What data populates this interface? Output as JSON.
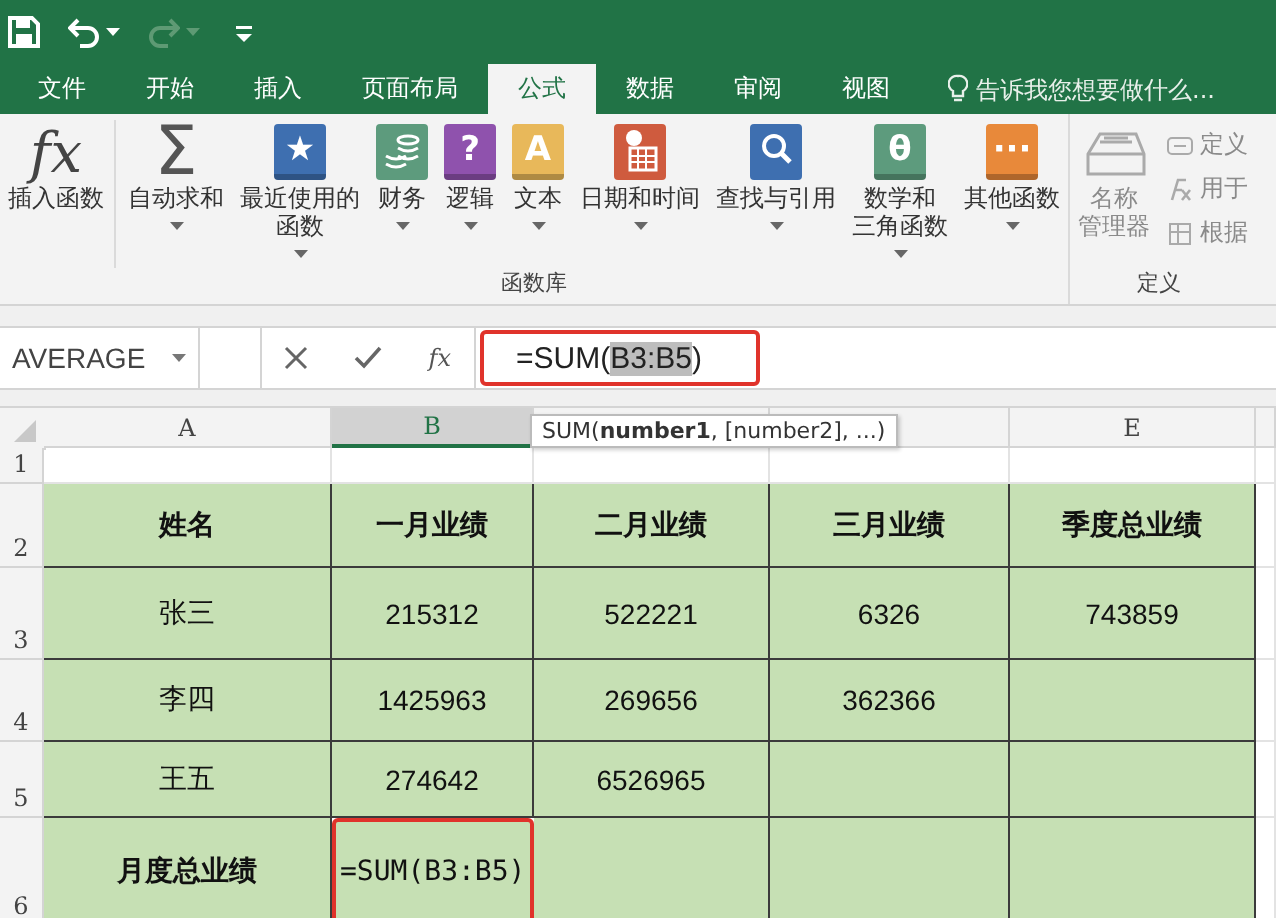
{
  "quick_access": [
    {
      "kind": "save",
      "disabled": false,
      "dropdown": false
    },
    {
      "kind": "undo",
      "disabled": false,
      "dropdown": true
    },
    {
      "kind": "redo",
      "disabled": true,
      "dropdown": true
    },
    {
      "kind": "customize",
      "disabled": false,
      "dropdown": false
    }
  ],
  "tabs": [
    {
      "label": "文件",
      "selected": false
    },
    {
      "label": "开始",
      "selected": false
    },
    {
      "label": "插入",
      "selected": false
    },
    {
      "label": "页面布局",
      "selected": false
    },
    {
      "label": "公式",
      "selected": true
    },
    {
      "label": "数据",
      "selected": false
    },
    {
      "label": "审阅",
      "selected": false
    },
    {
      "label": "视图",
      "selected": false
    }
  ],
  "tell_me": {
    "placeholder": "告诉我您想要做什么..."
  },
  "ribbon": {
    "groups": [
      {
        "label": "函数库",
        "buttons": [
          {
            "kind": "glyph",
            "glyph": "fx",
            "lines": [
              "插入函数"
            ],
            "dropdown": false,
            "disabled": false,
            "separator_after": true
          },
          {
            "kind": "sigma",
            "glyph": "Σ",
            "lines": [
              "自动求和"
            ],
            "dropdown": true,
            "disabled": false
          },
          {
            "kind": "book",
            "glyph": "★",
            "color": "#3e6fb0",
            "lines": [
              "最近使用的",
              "函数"
            ],
            "dropdown": true,
            "disabled": false
          },
          {
            "kind": "coins",
            "color": "#5d9b7d",
            "lines": [
              "财务"
            ],
            "dropdown": true,
            "disabled": false
          },
          {
            "kind": "book",
            "glyph": "?",
            "color": "#8f52ad",
            "lines": [
              "逻辑"
            ],
            "dropdown": true,
            "disabled": false
          },
          {
            "kind": "book",
            "glyph": "A",
            "color": "#e8b85a",
            "lines": [
              "文本"
            ],
            "dropdown": true,
            "disabled": false
          },
          {
            "kind": "calendar",
            "color": "#cf5b3e",
            "lines": [
              "日期和时间"
            ],
            "dropdown": true,
            "disabled": false
          },
          {
            "kind": "search",
            "color": "#3e6fb0",
            "lines": [
              "查找与引用"
            ],
            "dropdown": true,
            "disabled": false
          },
          {
            "kind": "book",
            "glyph": "θ",
            "color": "#5d9b7d",
            "lines": [
              "数学和",
              "三角函数"
            ],
            "dropdown": true,
            "disabled": false
          },
          {
            "kind": "book",
            "glyph": "···",
            "color": "#e8893a",
            "lines": [
              "其他函数"
            ],
            "dropdown": true,
            "disabled": false
          }
        ]
      },
      {
        "label": "定义",
        "buttons": [
          {
            "kind": "name-manager",
            "lines": [
              "名称",
              "管理器"
            ],
            "dropdown": false,
            "disabled": true
          }
        ],
        "small_buttons": [
          {
            "kind": "tag",
            "label": "定义",
            "disabled": true
          },
          {
            "kind": "fx",
            "label": "用于",
            "disabled": true
          },
          {
            "kind": "grid",
            "label": "根据",
            "disabled": true
          }
        ]
      }
    ]
  },
  "formula_bar": {
    "name_box": "AVERAGE",
    "formula_before": "=SUM(",
    "formula_selected": "B3:B5",
    "formula_after": ")",
    "highlighted": true
  },
  "tooltip": "SUM(**number1**, [number2], ...)",
  "grid": {
    "columns": [
      {
        "label": "A",
        "selected": false
      },
      {
        "label": "B",
        "selected": true
      },
      {
        "selected": false
      },
      {
        "selected": false
      },
      {
        "label": "E",
        "selected": false
      }
    ],
    "rows": [
      {
        "header": "1",
        "filled": false,
        "cells": [
          {},
          {},
          {},
          {},
          {}
        ]
      },
      {
        "header": "2",
        "filled": true,
        "cells": [
          {
            "text": "姓名",
            "bold": true
          },
          {
            "text": "一月业绩",
            "bold": true
          },
          {
            "text": "二月业绩",
            "bold": true
          },
          {
            "text": "三月业绩",
            "bold": true
          },
          {
            "text": "季度总业绩",
            "bold": true
          }
        ]
      },
      {
        "header": "3",
        "filled": true,
        "cells": [
          {
            "text": "张三"
          },
          {
            "text": "215312"
          },
          {
            "text": "522221"
          },
          {
            "text": "6326"
          },
          {
            "text": "743859"
          }
        ]
      },
      {
        "header": "4",
        "filled": true,
        "cells": [
          {
            "text": "李四"
          },
          {
            "text": "1425963"
          },
          {
            "text": "269656"
          },
          {
            "text": "362366"
          },
          {}
        ]
      },
      {
        "header": "5",
        "filled": true,
        "cells": [
          {
            "text": "王五"
          },
          {
            "text": "274642"
          },
          {
            "text": "6526965"
          },
          {},
          {}
        ]
      },
      {
        "header": "6",
        "filled": true,
        "cells": [
          {
            "text": "月度总业绩",
            "bold": true
          },
          {
            "text": "=SUM(B3:B5)",
            "editing": true
          },
          {},
          {},
          {}
        ]
      }
    ]
  }
}
